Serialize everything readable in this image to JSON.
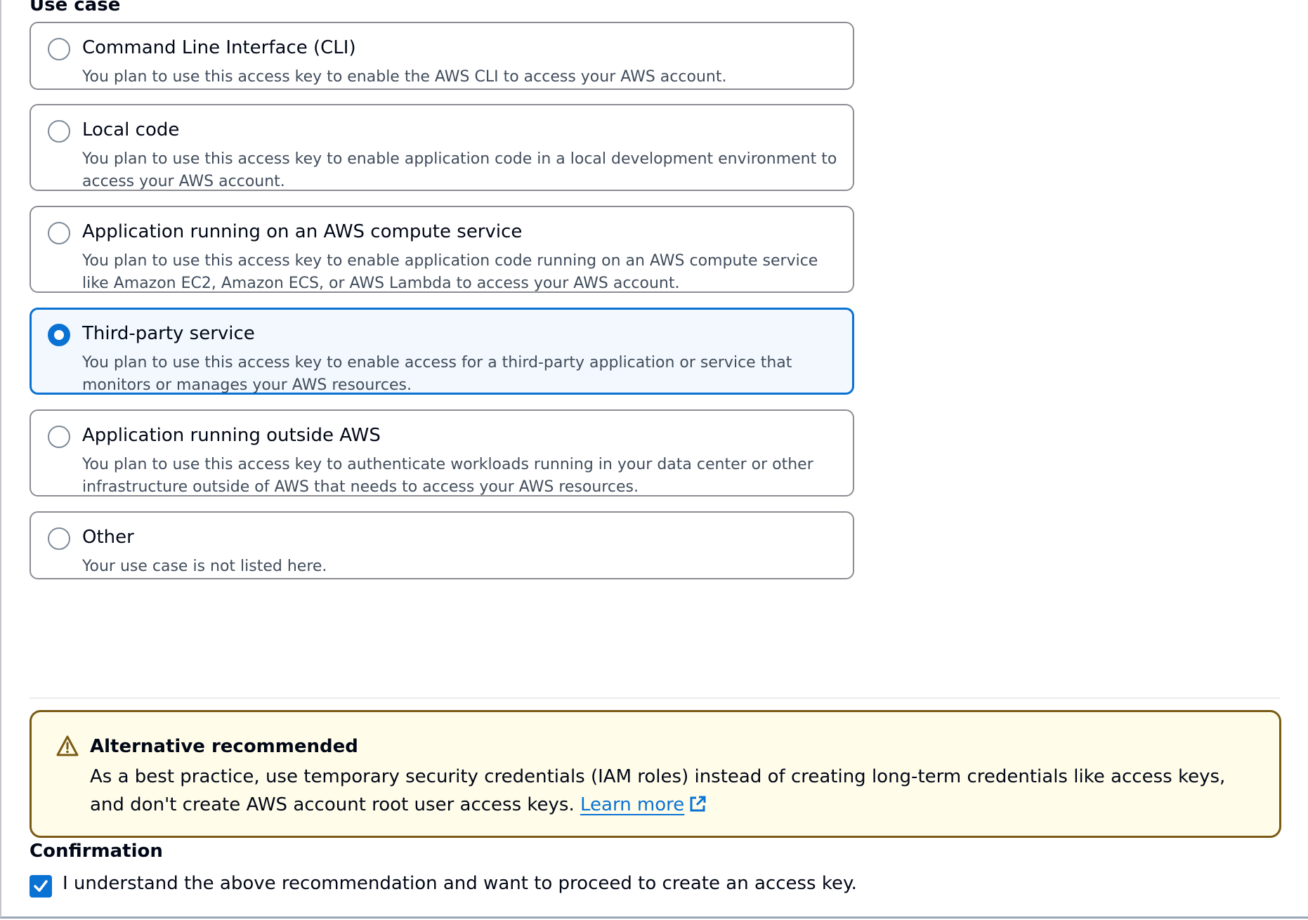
{
  "use_case": {
    "title": "Use case",
    "options": [
      {
        "title": "Command Line Interface (CLI)",
        "description": "You plan to use this access key to enable the AWS CLI to access your AWS account.",
        "selected": false
      },
      {
        "title": "Local code",
        "description": "You plan to use this access key to enable application code in a local development environment to access your AWS account.",
        "selected": false
      },
      {
        "title": "Application running on an AWS compute service",
        "description": "You plan to use this access key to enable application code running on an AWS compute service like Amazon EC2, Amazon ECS, or AWS Lambda to access your AWS account.",
        "selected": false
      },
      {
        "title": "Third-party service",
        "description": "You plan to use this access key to enable access for a third-party application or service that monitors or manages your AWS resources.",
        "selected": true
      },
      {
        "title": "Application running outside AWS",
        "description": "You plan to use this access key to authenticate workloads running in your data center or other infrastructure outside of AWS that needs to access your AWS resources.",
        "selected": false
      },
      {
        "title": "Other",
        "description": "Your use case is not listed here.",
        "selected": false
      }
    ]
  },
  "alert": {
    "icon": "warning-icon",
    "title": "Alternative recommended",
    "body": "As a best practice, use temporary security credentials (IAM roles) instead of creating long-term credentials like access keys, and don't create AWS account root user access keys.",
    "link_label": "Learn more",
    "link_icon": "external-link-icon"
  },
  "confirmation": {
    "title": "Confirmation",
    "checkbox_label": "I understand the above recommendation and want to proceed to create an access key.",
    "checked": true
  },
  "colors": {
    "accent": "#0972d3",
    "warning_border": "#7a5a14",
    "warning_bg": "#fffce9",
    "selected_bg": "#f2f8fd"
  }
}
